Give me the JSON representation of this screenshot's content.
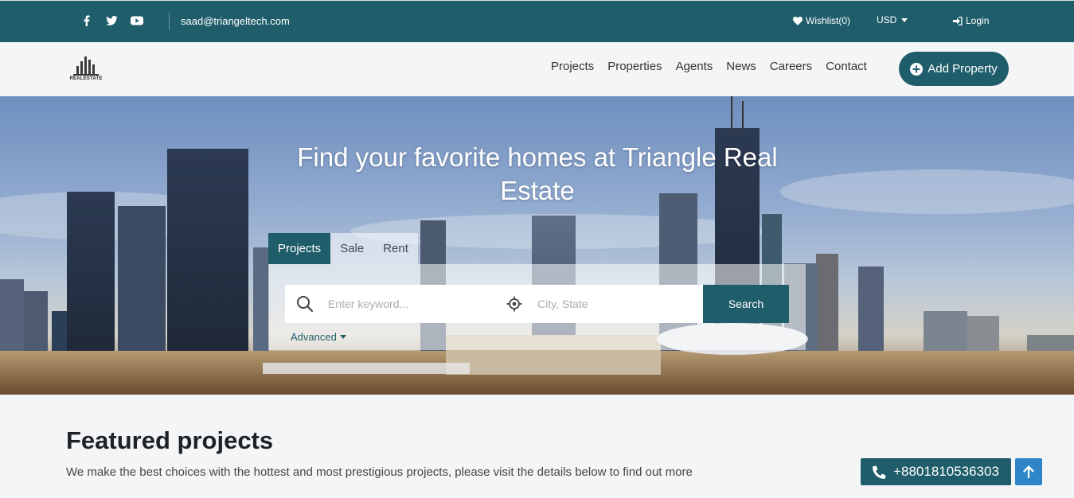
{
  "topbar": {
    "social_icons": [
      "facebook-icon",
      "twitter-icon",
      "youtube-icon"
    ],
    "email": "saad@triangeltech.com",
    "wishlist_label": "Wishlist(0)",
    "currency": "USD",
    "login_label": "Login"
  },
  "navbar": {
    "logo_text": "REALESTATE",
    "links": [
      "Projects",
      "Properties",
      "Agents",
      "News",
      "Careers",
      "Contact"
    ],
    "add_property_label": "Add Property"
  },
  "hero": {
    "title": "Find your favorite homes at Triangle Real Estate",
    "tabs": [
      {
        "label": "Projects",
        "active": true
      },
      {
        "label": "Sale",
        "active": false
      },
      {
        "label": "Rent",
        "active": false
      }
    ],
    "keyword_placeholder": "Enter keyword...",
    "city_placeholder": "City, State",
    "search_label": "Search",
    "advanced_label": "Advanced"
  },
  "featured": {
    "title": "Featured projects",
    "subtitle": "We make the best choices with the hottest and most prestigious projects, please visit the details below to find out more"
  },
  "floating": {
    "phone": "+8801810536303"
  },
  "colors": {
    "primary": "#1f5d6b",
    "scroll_top": "#2e86c8"
  }
}
